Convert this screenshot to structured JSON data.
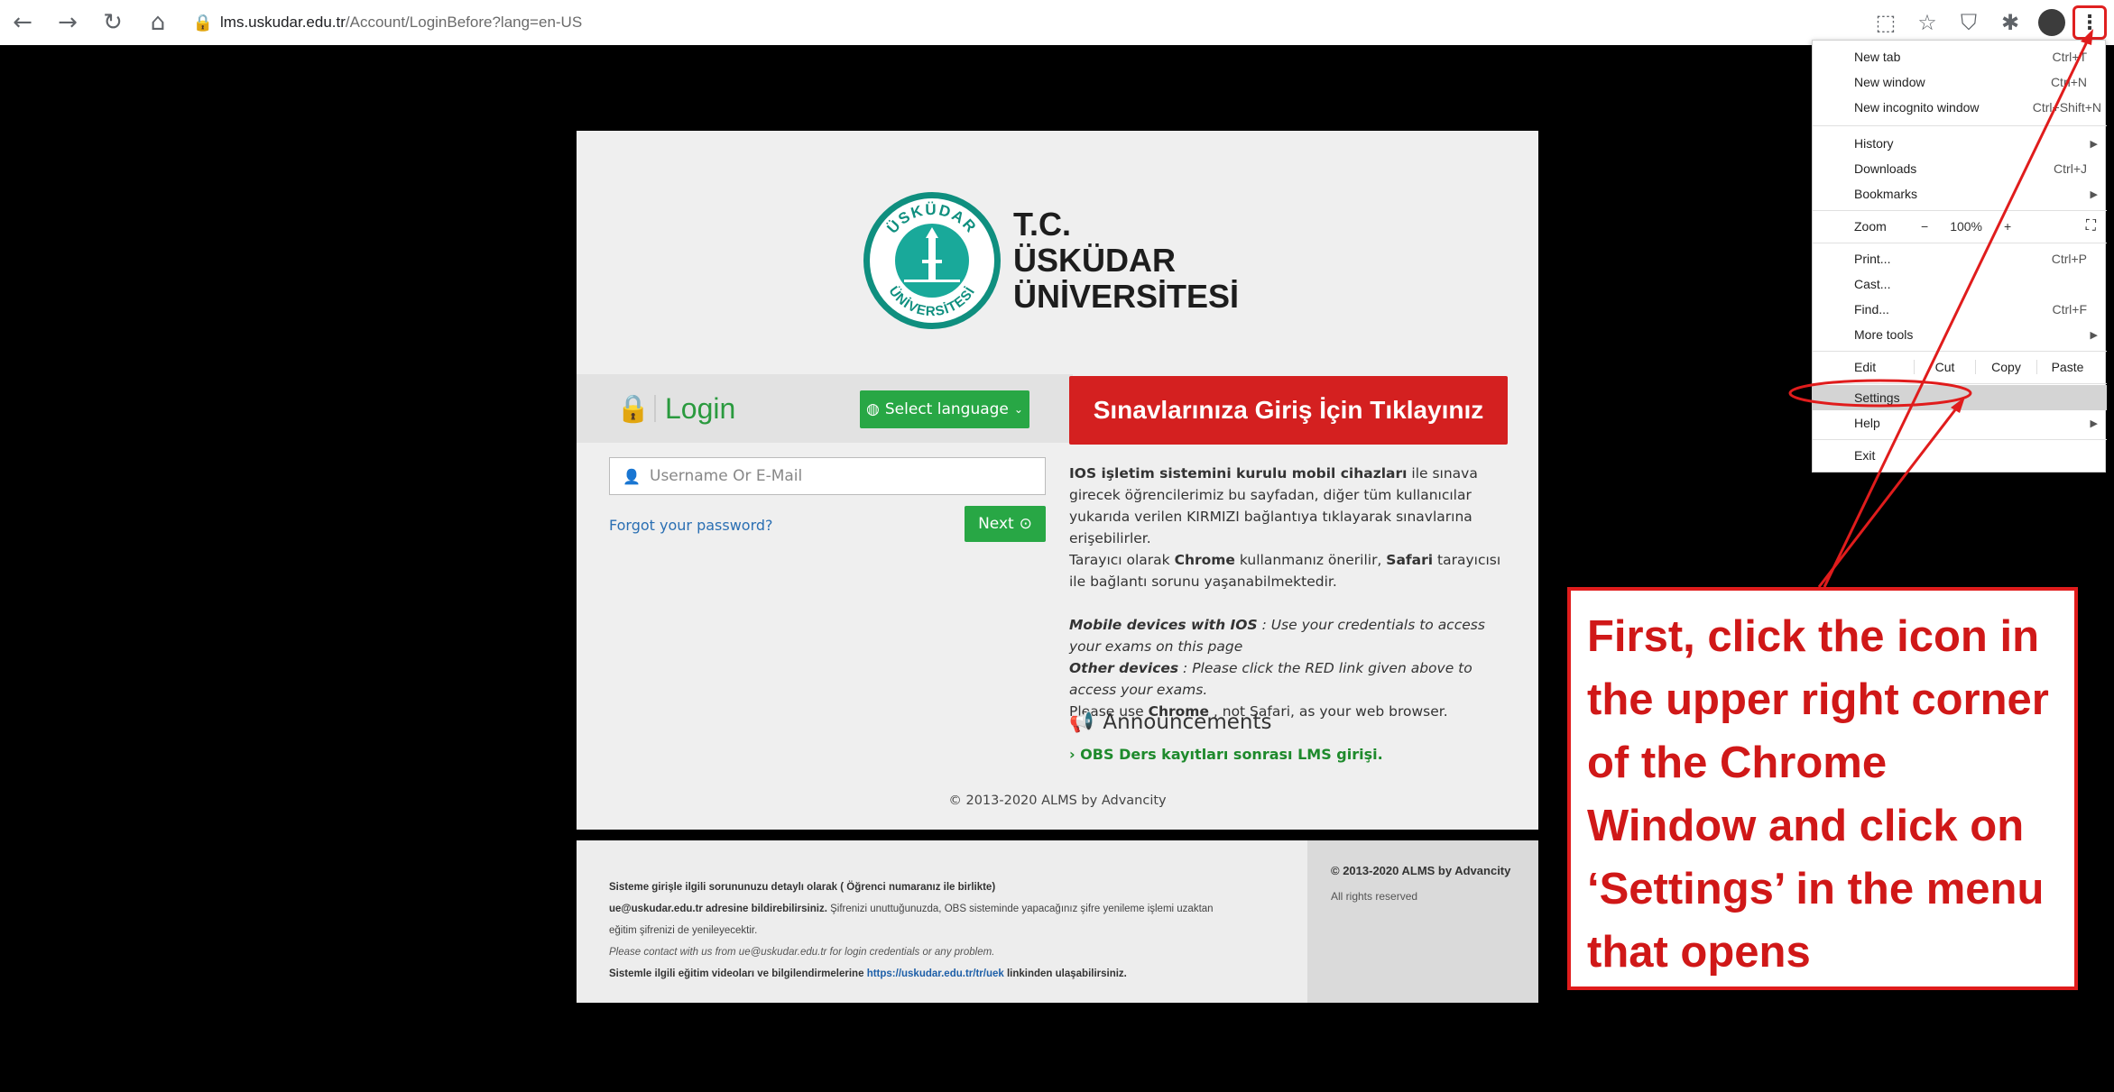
{
  "browser": {
    "url_host": "lms.uskudar.edu.tr",
    "url_path": "/Account/LoginBefore?lang=en-US",
    "back_icon": "back-arrow-icon",
    "forward_icon": "forward-arrow-icon",
    "reload_icon": "reload-icon",
    "home_icon": "home-icon"
  },
  "logo": {
    "line1": "T.C.",
    "line2": "ÜSKÜDAR",
    "line3": "ÜNİVERSİTESİ",
    "ring_top": "ÜSKÜDAR",
    "ring_bottom": "ÜNİVERSİTESİ",
    "brand_color": "#0f8f7f"
  },
  "login": {
    "title": "Login",
    "select_language": "Select language",
    "username_placeholder": "Username Or E-Mail",
    "forgot": "Forgot your password?",
    "next": "Next"
  },
  "exam_button": "Sınavlarınıza Giriş İçin Tıklayınız",
  "info": {
    "p1_bold": "IOS işletim sistemini kurulu mobil cihazları",
    "p1_rest": " ile sınava girecek öğrencilerimiz bu sayfadan, diğer tüm kullanıcılar yukarıda verilen KIRMIZI bağlantıya tıklayarak sınavlarına erişebilirler.",
    "p2_a": "Tarayıcı olarak ",
    "p2_b": "Chrome",
    "p2_c": " kullanmanız önerilir, ",
    "p2_d": "Safari",
    "p2_e": " tarayıcısı ile bağlantı sorunu yaşanabilmektedir.",
    "en1_bold": "Mobile devices with IOS",
    "en1_rest": " : Use your credentials to access your exams on this page",
    "en2_bold": "Other devices",
    "en2_rest": " : Please click the RED link given above to access your exams.",
    "en3_a": "Please use ",
    "en3_b": "Chrome",
    "en3_c": " , not Safari, as your web browser."
  },
  "announcements": {
    "title": "Announcements",
    "link": "OBS Ders kayıtları sonrası LMS girişi."
  },
  "card_footer": "© 2013-2020 ALMS by Advancity",
  "footer": {
    "l1": "Sisteme girişle ilgili sorununuzu detaylı olarak ( Öğrenci numaranız ile birlikte)",
    "l2_bold": "ue@uskudar.edu.tr adresine bildirebilirsiniz.",
    "l2_rest": " Şifrenizi unuttuğunuzda, OBS sisteminde yapacağınız şifre yenileme işlemi uzaktan",
    "l3": "eğitim şifrenizi de yenileyecektir.",
    "l4": "Please contact with us from ue@uskudar.edu.tr for login credentials or any problem.",
    "l5_a": "Sistemle ilgili eğitim videoları ve bilgilendirmelerine ",
    "l5_link": "https://uskudar.edu.tr/tr/uek",
    "l5_b": " linkinden ulaşabilirsiniz.",
    "right_title": "© 2013-2020 ALMS by Advancity",
    "right_sub": "All rights reserved"
  },
  "menu": {
    "new_tab": "New tab",
    "new_tab_sc": "Ctrl+T",
    "new_window": "New window",
    "new_window_sc": "Ctrl+N",
    "incognito": "New incognito window",
    "incognito_sc": "Ctrl+Shift+N",
    "history": "History",
    "downloads": "Downloads",
    "downloads_sc": "Ctrl+J",
    "bookmarks": "Bookmarks",
    "zoom": "Zoom",
    "zoom_minus": "−",
    "zoom_value": "100%",
    "zoom_plus": "+",
    "print": "Print...",
    "print_sc": "Ctrl+P",
    "cast": "Cast...",
    "find": "Find...",
    "find_sc": "Ctrl+F",
    "more_tools": "More tools",
    "edit": "Edit",
    "cut": "Cut",
    "copy": "Copy",
    "paste": "Paste",
    "settings": "Settings",
    "help": "Help",
    "exit": "Exit"
  },
  "callout": {
    "text": "First, click the icon in the upper right corner of the Chrome Window and click on ‘Settings’ in the menu that opens",
    "color": "#e01c1c"
  }
}
